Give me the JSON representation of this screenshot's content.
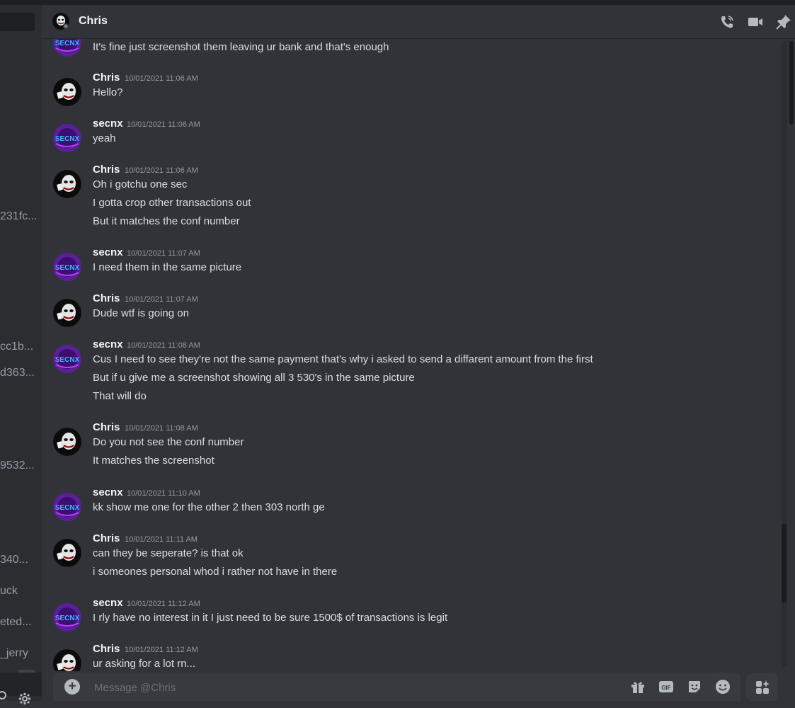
{
  "header": {
    "title": "Chris"
  },
  "sidebar": {
    "snippets": [
      "231fc...",
      "cc1b...",
      "d363...",
      "9532...",
      "340...",
      "uck",
      "eted...",
      "_jerry"
    ]
  },
  "messages": [
    {
      "author": "",
      "time": "",
      "avatar": "secnx",
      "lines": [
        "It's fine just screenshot them leaving ur bank and that's enough"
      ]
    },
    {
      "author": "Chris",
      "time": "10/01/2021 11:06 AM",
      "avatar": "joker",
      "lines": [
        "Hello?"
      ]
    },
    {
      "author": "secnx",
      "time": "10/01/2021 11:06 AM",
      "avatar": "secnx",
      "lines": [
        "yeah"
      ]
    },
    {
      "author": "Chris",
      "time": "10/01/2021 11:06 AM",
      "avatar": "joker",
      "lines": [
        "Oh i gotchu one sec",
        "I gotta crop other transactions out",
        "But it matches the conf number"
      ]
    },
    {
      "author": "secnx",
      "time": "10/01/2021 11:07 AM",
      "avatar": "secnx",
      "lines": [
        "I need them in the same picture"
      ]
    },
    {
      "author": "Chris",
      "time": "10/01/2021 11:07 AM",
      "avatar": "joker",
      "lines": [
        "Dude wtf is going on"
      ]
    },
    {
      "author": "secnx",
      "time": "10/01/2021 11:08 AM",
      "avatar": "secnx",
      "lines": [
        "Cus I need to see they're not the same payment that's why i asked to send a diffarent amount from the first",
        "But if u give me a screenshot showing all 3 530's in the same picture",
        "That will do"
      ]
    },
    {
      "author": "Chris",
      "time": "10/01/2021 11:08 AM",
      "avatar": "joker",
      "lines": [
        "Do you not see the conf number",
        "It matches the screenshot"
      ]
    },
    {
      "author": "secnx",
      "time": "10/01/2021 11:10 AM",
      "avatar": "secnx",
      "lines": [
        "kk show me one for the other 2 then 303 north ge"
      ]
    },
    {
      "author": "Chris",
      "time": "10/01/2021 11:11 AM",
      "avatar": "joker",
      "lines": [
        "can they be seperate? is that ok",
        "i someones personal whod i rather not have in there"
      ]
    },
    {
      "author": "secnx",
      "time": "10/01/2021 11:12 AM",
      "avatar": "secnx",
      "lines": [
        "I rly have no interest in it I just need to be sure 1500$ of transactions is legit"
      ]
    },
    {
      "author": "Chris",
      "time": "10/01/2021 11:12 AM",
      "avatar": "joker",
      "lines": [
        "ur asking for a lot rn..."
      ]
    }
  ],
  "composer": {
    "placeholder": "Message @Chris"
  },
  "avatar_labels": {
    "secnx": "SECNX"
  },
  "colors": {
    "background": "#313338",
    "sidebar": "#2b2d31",
    "composer": "#383a40",
    "secnx_avatar": "#5b1f9c",
    "secnx_text": "#38b6ff"
  }
}
